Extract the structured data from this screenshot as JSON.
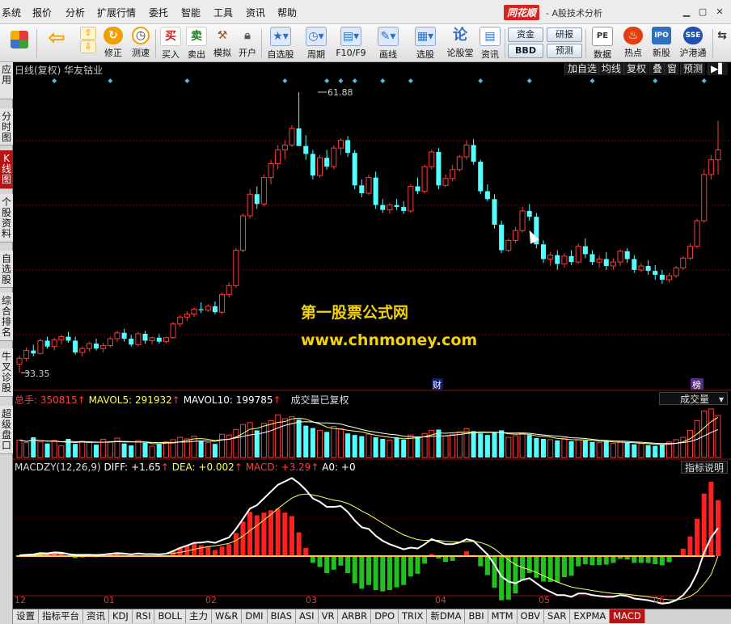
{
  "menu": [
    "系统",
    "报价",
    "分析",
    "扩展行情",
    "委托",
    "智能",
    "工具",
    "资讯",
    "帮助"
  ],
  "brand": "同花顺",
  "app_title": "- A股技术分析",
  "toolbar": [
    {
      "name": "layout-button",
      "label": "",
      "icon": "grid-icon",
      "color": "#e04040"
    },
    {
      "name": "back-button",
      "label": "",
      "icon": "arrow-left-icon",
      "color": "#f0a000"
    },
    {
      "name": "fix-button",
      "label": "修正",
      "icon": "arrow-up-icon",
      "color": "#f0a000"
    },
    {
      "name": "speed-button",
      "label": "测速",
      "icon": "clock-icon",
      "color": "#f0a000"
    },
    {
      "name": "buy-button",
      "label": "买入",
      "icon": "买",
      "color": "#d02020"
    },
    {
      "name": "sell-button",
      "label": "卖出",
      "icon": "卖",
      "color": "#208020"
    },
    {
      "name": "simulate-button",
      "label": "模拟",
      "icon": "hammer-icon",
      "color": "#a05020"
    },
    {
      "name": "open-account-button",
      "label": "开户",
      "icon": "lock-icon",
      "color": "#606060"
    },
    {
      "name": "self-select-button",
      "label": "自选股",
      "icon": "star-icon",
      "color": "#3070c0"
    },
    {
      "name": "period-button",
      "label": "周期",
      "icon": "clock-icon",
      "color": "#3070c0"
    },
    {
      "name": "f10-button",
      "label": "F10/F9",
      "icon": "doc-icon",
      "color": "#3070c0"
    },
    {
      "name": "draw-button",
      "label": "画线",
      "icon": "pen-icon",
      "color": "#3070c0"
    },
    {
      "name": "stock-pick-button",
      "label": "选股",
      "icon": "chart-icon",
      "color": "#3070c0"
    },
    {
      "name": "forum-button",
      "label": "论股堂",
      "icon": "论",
      "color": "#3070c0"
    },
    {
      "name": "news-button",
      "label": "资讯",
      "icon": "doc-icon",
      "color": "#3070c0"
    }
  ],
  "pills": {
    "funds": "资金",
    "research": "研报",
    "bbd": "BBD",
    "forecast": "预测"
  },
  "toolbar_right": [
    {
      "name": "data-button",
      "label": "数据",
      "icon": "PE"
    },
    {
      "name": "hot-button",
      "label": "热点",
      "icon": "flame-icon"
    },
    {
      "name": "new-stock-button",
      "label": "新股",
      "icon": "IPO"
    },
    {
      "name": "hk-connect-button",
      "label": "沪港通",
      "icon": "SSE"
    }
  ],
  "side_tabs": [
    {
      "name": "side-tab-apps",
      "label": "应用",
      "active": false
    },
    {
      "name": "side-tab-intraday",
      "label": "分时图",
      "active": false
    },
    {
      "name": "side-tab-kline",
      "label": "K线图",
      "active": true
    },
    {
      "name": "side-tab-profile",
      "label": "个股资料",
      "active": false
    },
    {
      "name": "side-tab-watchlist",
      "label": "自选股",
      "active": false
    },
    {
      "name": "side-tab-ranking",
      "label": "综合排名",
      "active": false
    },
    {
      "name": "side-tab-diagnose",
      "label": "牛叉诊股",
      "active": false
    },
    {
      "name": "side-tab-superlevel",
      "label": "超级盘口",
      "active": false
    }
  ],
  "kline_header": {
    "title": "日线(复权) 华友钴业",
    "buttons": [
      "加自选",
      "均线",
      "复权",
      "叠",
      "窗",
      "预测"
    ]
  },
  "price_labels": {
    "high": "61.88",
    "low": "33.35"
  },
  "markers": {
    "finance": "财",
    "rank": "榜"
  },
  "volume_bar": {
    "total_label": "总手: ",
    "total": "350815",
    "mavol5_label": "MAVOL5: ",
    "mavol5": "291932",
    "mavol10_label": "MAVOL10: ",
    "mavol10": "199785",
    "note": "成交量已复权",
    "selector": "成交量"
  },
  "macd_bar": {
    "name": "MACDZY(12,26,9)",
    "diff_label": "DIFF: ",
    "diff": "+1.65",
    "dea_label": "DEA: ",
    "dea": "+0.002",
    "macd_label": "MACD: ",
    "macd": "+3.29",
    "a0_label": "A0: ",
    "a0": "+0",
    "button": "指标说明"
  },
  "watermark": {
    "line1": "第一股票公式网",
    "line2": "www.chnmoney.com"
  },
  "x_axis_labels": [
    "12",
    "01",
    "02",
    "03",
    "04",
    "05",
    "06"
  ],
  "bottom_tabs": [
    {
      "label": "设置",
      "active": false
    },
    {
      "label": "指标平台",
      "active": false
    },
    {
      "label": "资讯",
      "active": false
    },
    {
      "label": "KDJ",
      "active": false
    },
    {
      "label": "RSI",
      "active": false
    },
    {
      "label": "BOLL",
      "active": false
    },
    {
      "label": "主力",
      "active": false
    },
    {
      "label": "W&R",
      "active": false
    },
    {
      "label": "DMI",
      "active": false
    },
    {
      "label": "BIAS",
      "active": false
    },
    {
      "label": "ASI",
      "active": false
    },
    {
      "label": "VR",
      "active": false
    },
    {
      "label": "ARBR",
      "active": false
    },
    {
      "label": "DPO",
      "active": false
    },
    {
      "label": "TRIX",
      "active": false
    },
    {
      "label": "新DMA",
      "active": false
    },
    {
      "label": "BBI",
      "active": false
    },
    {
      "label": "MTM",
      "active": false
    },
    {
      "label": "OBV",
      "active": false
    },
    {
      "label": "SAR",
      "active": false
    },
    {
      "label": "EXPMA",
      "active": false
    },
    {
      "label": "MACD",
      "active": true
    }
  ],
  "colors": {
    "up": "#ff3b3b",
    "down": "#54ffff",
    "diff": "#ffffff",
    "dea": "#ffff66",
    "macd_pos": "#ff2020",
    "macd_neg": "#20c020",
    "grid": "#7a1010"
  },
  "chart_data": {
    "type": "candlestick",
    "title": "日线(复权) 华友钴业",
    "price_range": [
      33.35,
      61.88
    ],
    "candles": [
      [
        34.2,
        35.1,
        33.35,
        34.8
      ],
      [
        34.8,
        35.9,
        34.5,
        35.6
      ],
      [
        35.6,
        36.2,
        35.0,
        35.3
      ],
      [
        35.3,
        36.8,
        35.2,
        36.6
      ],
      [
        36.6,
        37.0,
        35.8,
        36.0
      ],
      [
        36.0,
        36.9,
        35.6,
        36.7
      ],
      [
        36.7,
        37.2,
        36.2,
        37.0
      ],
      [
        37.0,
        37.5,
        36.4,
        36.6
      ],
      [
        36.6,
        37.0,
        35.2,
        35.4
      ],
      [
        35.4,
        36.0,
        35.0,
        35.8
      ],
      [
        35.8,
        36.5,
        35.5,
        36.3
      ],
      [
        36.3,
        36.8,
        35.6,
        35.8
      ],
      [
        35.8,
        36.4,
        35.4,
        36.1
      ],
      [
        36.1,
        37.0,
        35.9,
        36.8
      ],
      [
        36.8,
        37.6,
        36.5,
        37.4
      ],
      [
        37.4,
        37.8,
        36.5,
        36.8
      ],
      [
        36.8,
        37.2,
        36.0,
        36.2
      ],
      [
        36.2,
        37.5,
        36.0,
        37.3
      ],
      [
        37.3,
        37.6,
        36.3,
        36.6
      ],
      [
        36.6,
        37.0,
        36.2,
        36.9
      ],
      [
        36.9,
        37.3,
        36.3,
        36.5
      ],
      [
        36.5,
        37.0,
        36.3,
        36.9
      ],
      [
        36.9,
        38.5,
        36.8,
        38.3
      ],
      [
        38.3,
        39.2,
        38.0,
        39.0
      ],
      [
        39.0,
        39.6,
        38.6,
        39.3
      ],
      [
        39.3,
        40.0,
        39.0,
        39.8
      ],
      [
        39.8,
        40.5,
        39.4,
        39.7
      ],
      [
        39.7,
        40.3,
        39.5,
        40.1
      ],
      [
        40.1,
        40.6,
        39.3,
        39.5
      ],
      [
        39.5,
        41.5,
        39.3,
        41.3
      ],
      [
        41.3,
        42.5,
        41.0,
        42.2
      ],
      [
        42.2,
        46.0,
        42.0,
        45.8
      ],
      [
        45.8,
        49.5,
        45.6,
        49.3
      ],
      [
        49.3,
        52.0,
        49.0,
        51.5
      ],
      [
        51.5,
        52.3,
        50.0,
        50.5
      ],
      [
        50.5,
        53.5,
        50.3,
        53.2
      ],
      [
        53.2,
        55.0,
        52.5,
        54.6
      ],
      [
        54.6,
        56.5,
        54.0,
        56.0
      ],
      [
        56.0,
        57.0,
        55.0,
        56.5
      ],
      [
        56.5,
        58.5,
        56.3,
        58.2
      ],
      [
        58.2,
        61.88,
        57.8,
        56.4
      ],
      [
        56.4,
        57.5,
        55.0,
        55.6
      ],
      [
        55.6,
        56.0,
        53.0,
        53.4
      ],
      [
        53.4,
        55.5,
        53.2,
        55.2
      ],
      [
        55.2,
        56.0,
        54.0,
        54.3
      ],
      [
        54.3,
        56.5,
        54.0,
        56.2
      ],
      [
        56.2,
        57.2,
        55.5,
        57.0
      ],
      [
        57.0,
        57.4,
        55.3,
        55.7
      ],
      [
        55.7,
        56.0,
        52.0,
        52.4
      ],
      [
        52.4,
        53.0,
        51.2,
        51.6
      ],
      [
        51.6,
        53.5,
        51.4,
        53.2
      ],
      [
        53.2,
        53.8,
        50.0,
        50.4
      ],
      [
        50.4,
        51.0,
        49.6,
        49.9
      ],
      [
        49.9,
        50.6,
        49.5,
        50.4
      ],
      [
        50.4,
        51.0,
        49.9,
        50.2
      ],
      [
        50.2,
        50.8,
        49.5,
        49.8
      ],
      [
        49.8,
        52.5,
        49.6,
        52.3
      ],
      [
        52.3,
        53.2,
        51.5,
        51.8
      ],
      [
        51.8,
        54.5,
        51.6,
        54.3
      ],
      [
        54.3,
        56.0,
        54.0,
        55.8
      ],
      [
        55.8,
        56.2,
        52.0,
        52.4
      ],
      [
        52.4,
        53.5,
        52.2,
        53.1
      ],
      [
        53.1,
        54.5,
        52.8,
        54.0
      ],
      [
        54.0,
        55.5,
        53.8,
        55.3
      ],
      [
        55.3,
        57.0,
        55.0,
        56.5
      ],
      [
        56.5,
        57.1,
        54.5,
        54.8
      ],
      [
        54.8,
        55.0,
        51.5,
        51.8
      ],
      [
        51.8,
        52.5,
        50.8,
        51.0
      ],
      [
        51.0,
        51.5,
        48.0,
        48.4
      ],
      [
        48.4,
        48.8,
        45.5,
        45.8
      ],
      [
        45.8,
        47.0,
        45.6,
        46.8
      ],
      [
        46.8,
        48.2,
        46.5,
        47.8
      ],
      [
        47.8,
        50.2,
        47.6,
        49.8
      ],
      [
        49.8,
        50.5,
        48.8,
        49.2
      ],
      [
        49.2,
        49.6,
        46.0,
        46.4
      ],
      [
        46.4,
        46.8,
        44.5,
        44.9
      ],
      [
        44.9,
        45.6,
        44.2,
        45.3
      ],
      [
        45.3,
        45.8,
        43.8,
        44.4
      ],
      [
        44.4,
        45.5,
        44.0,
        45.2
      ],
      [
        45.2,
        45.8,
        44.3,
        44.6
      ],
      [
        44.6,
        46.5,
        44.4,
        46.2
      ],
      [
        46.2,
        47.0,
        45.0,
        45.4
      ],
      [
        45.4,
        45.8,
        44.3,
        44.6
      ],
      [
        44.6,
        45.3,
        44.0,
        44.9
      ],
      [
        44.9,
        45.6,
        43.8,
        44.2
      ],
      [
        44.2,
        45.0,
        43.8,
        44.6
      ],
      [
        44.6,
        45.9,
        44.2,
        45.7
      ],
      [
        45.7,
        46.0,
        44.5,
        44.9
      ],
      [
        44.9,
        45.3,
        43.5,
        43.8
      ],
      [
        43.8,
        44.5,
        43.6,
        44.2
      ],
      [
        44.2,
        44.8,
        43.3,
        43.7
      ],
      [
        43.7,
        44.3,
        42.8,
        43.3
      ],
      [
        43.3,
        43.8,
        42.4,
        42.8
      ],
      [
        42.8,
        43.5,
        42.5,
        43.2
      ],
      [
        43.2,
        44.2,
        43.0,
        44.0
      ],
      [
        44.0,
        45.2,
        43.8,
        45.0
      ],
      [
        45.0,
        46.5,
        44.8,
        46.2
      ],
      [
        46.2,
        49.0,
        46.0,
        48.8
      ],
      [
        48.8,
        54.0,
        48.6,
        53.5
      ],
      [
        53.5,
        55.5,
        53.0,
        55.0
      ],
      [
        55.0,
        59.0,
        53.5,
        56.0
      ]
    ],
    "volume": [
      45,
      38,
      52,
      40,
      36,
      44,
      30,
      48,
      35,
      42,
      39,
      33,
      47,
      41,
      50,
      36,
      31,
      44,
      38,
      29,
      34,
      40,
      46,
      52,
      48,
      55,
      42,
      38,
      35,
      60,
      58,
      72,
      85,
      90,
      70,
      88,
      95,
      110,
      100,
      105,
      98,
      82,
      76,
      70,
      66,
      80,
      74,
      62,
      58,
      55,
      60,
      52,
      48,
      45,
      50,
      46,
      58,
      54,
      62,
      70,
      72,
      55,
      60,
      66,
      74,
      68,
      62,
      58,
      64,
      70,
      52,
      56,
      62,
      58,
      50,
      48,
      46,
      44,
      50,
      42,
      46,
      44,
      40,
      38,
      42,
      36,
      40,
      38,
      34,
      36,
      32,
      30,
      34,
      40,
      46,
      52,
      70,
      95,
      120,
      125,
      108
    ],
    "diff": [
      0.05,
      0.08,
      0.1,
      0.18,
      0.16,
      0.22,
      0.2,
      0.12,
      0.05,
      0.06,
      0.08,
      0.06,
      0.09,
      0.14,
      0.18,
      0.15,
      0.1,
      0.16,
      0.12,
      0.12,
      0.1,
      0.14,
      0.3,
      0.48,
      0.62,
      0.78,
      0.8,
      0.85,
      0.78,
      0.95,
      1.1,
      1.6,
      2.2,
      2.8,
      3.0,
      3.4,
      3.8,
      4.2,
      4.4,
      4.6,
      4.3,
      3.9,
      3.4,
      3.2,
      2.9,
      2.9,
      2.95,
      2.6,
      2.1,
      1.7,
      1.6,
      1.2,
      0.9,
      0.7,
      0.55,
      0.4,
      0.5,
      0.45,
      0.7,
      1.0,
      0.85,
      0.7,
      0.7,
      0.8,
      1.0,
      0.9,
      0.5,
      0.1,
      -0.5,
      -1.2,
      -1.5,
      -1.6,
      -1.4,
      -1.3,
      -1.6,
      -1.9,
      -2.1,
      -2.3,
      -2.3,
      -2.4,
      -2.2,
      -2.2,
      -2.3,
      -2.35,
      -2.4,
      -2.4,
      -2.3,
      -2.35,
      -2.5,
      -2.55,
      -2.6,
      -2.7,
      -2.8,
      -2.75,
      -2.6,
      -2.3,
      -1.8,
      -1.0,
      0.2,
      1.1,
      1.65
    ],
    "dea": [
      0.02,
      0.03,
      0.05,
      0.08,
      0.1,
      0.12,
      0.14,
      0.13,
      0.11,
      0.1,
      0.1,
      0.09,
      0.09,
      0.1,
      0.12,
      0.12,
      0.12,
      0.13,
      0.13,
      0.13,
      0.12,
      0.13,
      0.16,
      0.22,
      0.3,
      0.4,
      0.48,
      0.56,
      0.6,
      0.67,
      0.75,
      0.92,
      1.18,
      1.5,
      1.8,
      2.12,
      2.45,
      2.8,
      3.12,
      3.42,
      3.6,
      3.66,
      3.6,
      3.52,
      3.4,
      3.3,
      3.23,
      3.1,
      2.9,
      2.66,
      2.45,
      2.2,
      1.94,
      1.7,
      1.47,
      1.25,
      1.1,
      0.97,
      0.92,
      0.94,
      0.92,
      0.87,
      0.84,
      0.83,
      0.86,
      0.87,
      0.8,
      0.66,
      0.43,
      0.1,
      -0.22,
      -0.5,
      -0.68,
      -0.8,
      -0.96,
      -1.15,
      -1.34,
      -1.53,
      -1.68,
      -1.82,
      -1.9,
      -1.96,
      -2.03,
      -2.09,
      -2.15,
      -2.2,
      -2.22,
      -2.25,
      -2.3,
      -2.35,
      -2.4,
      -2.46,
      -2.53,
      -2.57,
      -2.58,
      -2.52,
      -2.38,
      -2.1,
      -1.64,
      -1.09,
      0.002
    ]
  }
}
